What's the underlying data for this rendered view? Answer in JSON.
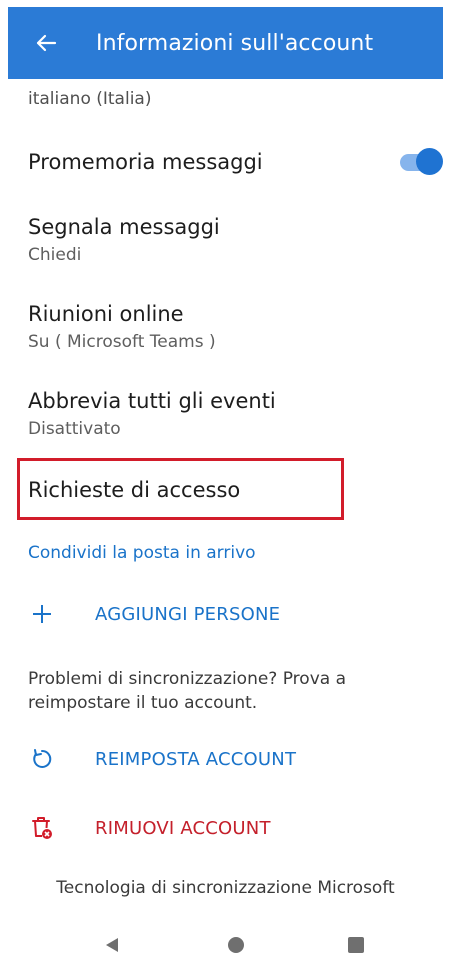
{
  "header": {
    "title": "Informazioni sull'account"
  },
  "language": {
    "value": "italiano (Italia)"
  },
  "settings": {
    "reminders": {
      "title": "Promemoria messaggi"
    },
    "report": {
      "title": "Segnala messaggi",
      "subtitle": "Chiedi"
    },
    "meetings": {
      "title": "Riunioni online",
      "subtitle": "Su ( Microsoft Teams )"
    },
    "abbreviate": {
      "title": "Abbrevia tutti gli eventi",
      "subtitle": "Disattivato"
    },
    "access_requests": {
      "title": "Richieste di accesso"
    }
  },
  "share": {
    "link": "Condividi la posta in arrivo"
  },
  "actions": {
    "add_people": "AGGIUNGI PERSONE",
    "sync_message": "Problemi di sincronizzazione? Prova a reimpostare il tuo account.",
    "reset_account": "REIMPOSTA ACCOUNT",
    "remove_account": "RIMUOVI ACCOUNT"
  },
  "footer": {
    "text": "Tecnologia di sincronizzazione Microsoft"
  },
  "colors": {
    "accent": "#2b7bd6",
    "danger": "#d21c2a",
    "highlight_border": "#d21c2a"
  }
}
